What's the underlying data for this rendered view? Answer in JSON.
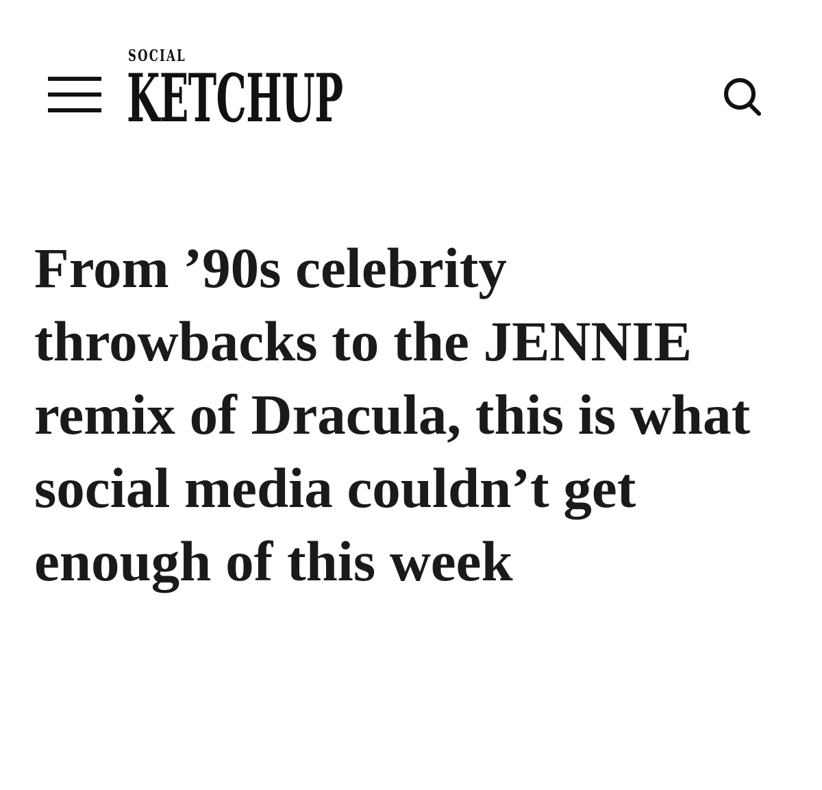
{
  "header": {
    "menu_icon": "hamburger-menu-icon",
    "logo": {
      "small_text": "SOCIAL",
      "big_text": "KETCHUP"
    },
    "search_icon": "search-icon"
  },
  "article": {
    "headline": "From ’90s celebrity throwbacks to the JENNIE remix of Dracula, this is what social media couldn’t get enough of this week"
  }
}
